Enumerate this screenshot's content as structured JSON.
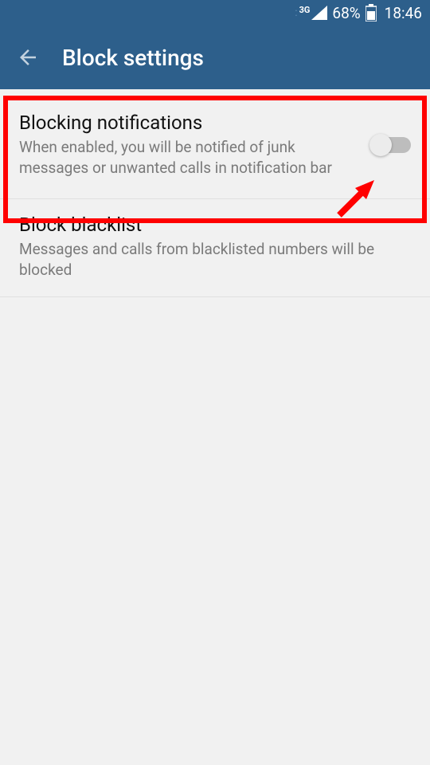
{
  "statusbar": {
    "network": "3G",
    "battery": "68%",
    "time": "18:46"
  },
  "appbar": {
    "title": "Block settings"
  },
  "settings": [
    {
      "title": "Blocking notifications",
      "desc": "When enabled, you will be notified of junk messages or unwanted calls in notification bar",
      "toggle": false
    },
    {
      "title": "Block blacklist",
      "desc": "Messages and calls from blacklisted numbers will be blocked"
    }
  ]
}
